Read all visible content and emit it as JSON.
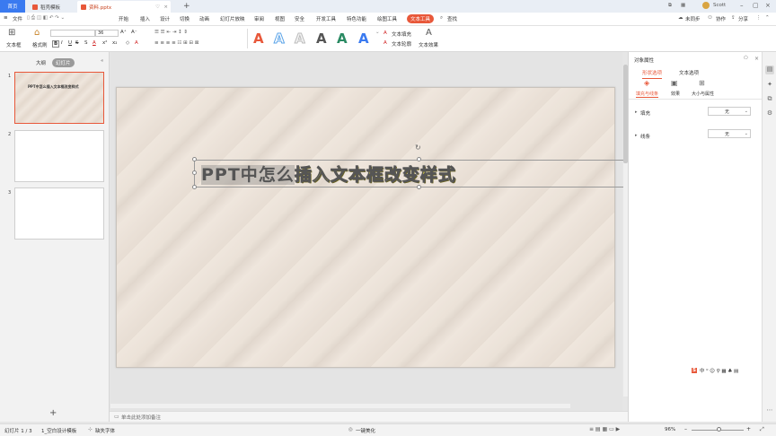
{
  "titlebar": {
    "tabs": [
      {
        "label": "首页"
      },
      {
        "label": "稻壳模板"
      },
      {
        "label": "资料.pptx"
      }
    ],
    "user": "Scott",
    "colors": {
      "home": "#3a7af0",
      "doc_icon": "#e8583a",
      "template_icon": "#e8583a"
    }
  },
  "menu": {
    "file": "文件",
    "items": [
      "开始",
      "插入",
      "设计",
      "切换",
      "动画",
      "幻灯片放映",
      "审阅",
      "视图",
      "安全",
      "开发工具",
      "特色功能",
      "绘图工具",
      "文本工具"
    ],
    "search": "查找",
    "sync": "未同步",
    "collab": "协作",
    "share": "分享",
    "active_color": "#e8583a"
  },
  "toolbar": {
    "textbox": "文本框",
    "format_painter": "格式刷",
    "font_size": "36",
    "text_fill": "文本填充",
    "text_outline": "文本轮廓",
    "text_effects": "文本效果",
    "wordart_colors": [
      "#e8583a",
      "#5aa3e8",
      "#cfcfcf",
      "#2a8a63",
      "#2a8a63",
      "#3a7af0"
    ]
  },
  "leftpane": {
    "tabs": [
      "大纲",
      "幻灯片"
    ],
    "slides": [
      {
        "num": "1",
        "title_a": "PPT中怎么",
        "title_b": "插入文本框改变样式"
      },
      {
        "num": "2"
      },
      {
        "num": "3"
      }
    ],
    "add": "+"
  },
  "slide": {
    "text_plain": "PPT中怎么",
    "text_styled": "插入文本框改变样式",
    "styled_color": "#f0e43a"
  },
  "rightpane": {
    "title": "对象属性",
    "tabs": [
      "形状选项",
      "文本选项"
    ],
    "subtabs": [
      "填充与线条",
      "效果",
      "大小与属性"
    ],
    "fill_label": "填充",
    "fill_value": "无",
    "line_label": "线条",
    "line_value": "无"
  },
  "notes": {
    "placeholder": "单击此处添加备注"
  },
  "status": {
    "slide_count": "幻灯片 1 / 3",
    "theme": "1_空白设计模板",
    "missing_font": "缺失字体",
    "beautify": "一键美化",
    "zoom": "96%"
  }
}
